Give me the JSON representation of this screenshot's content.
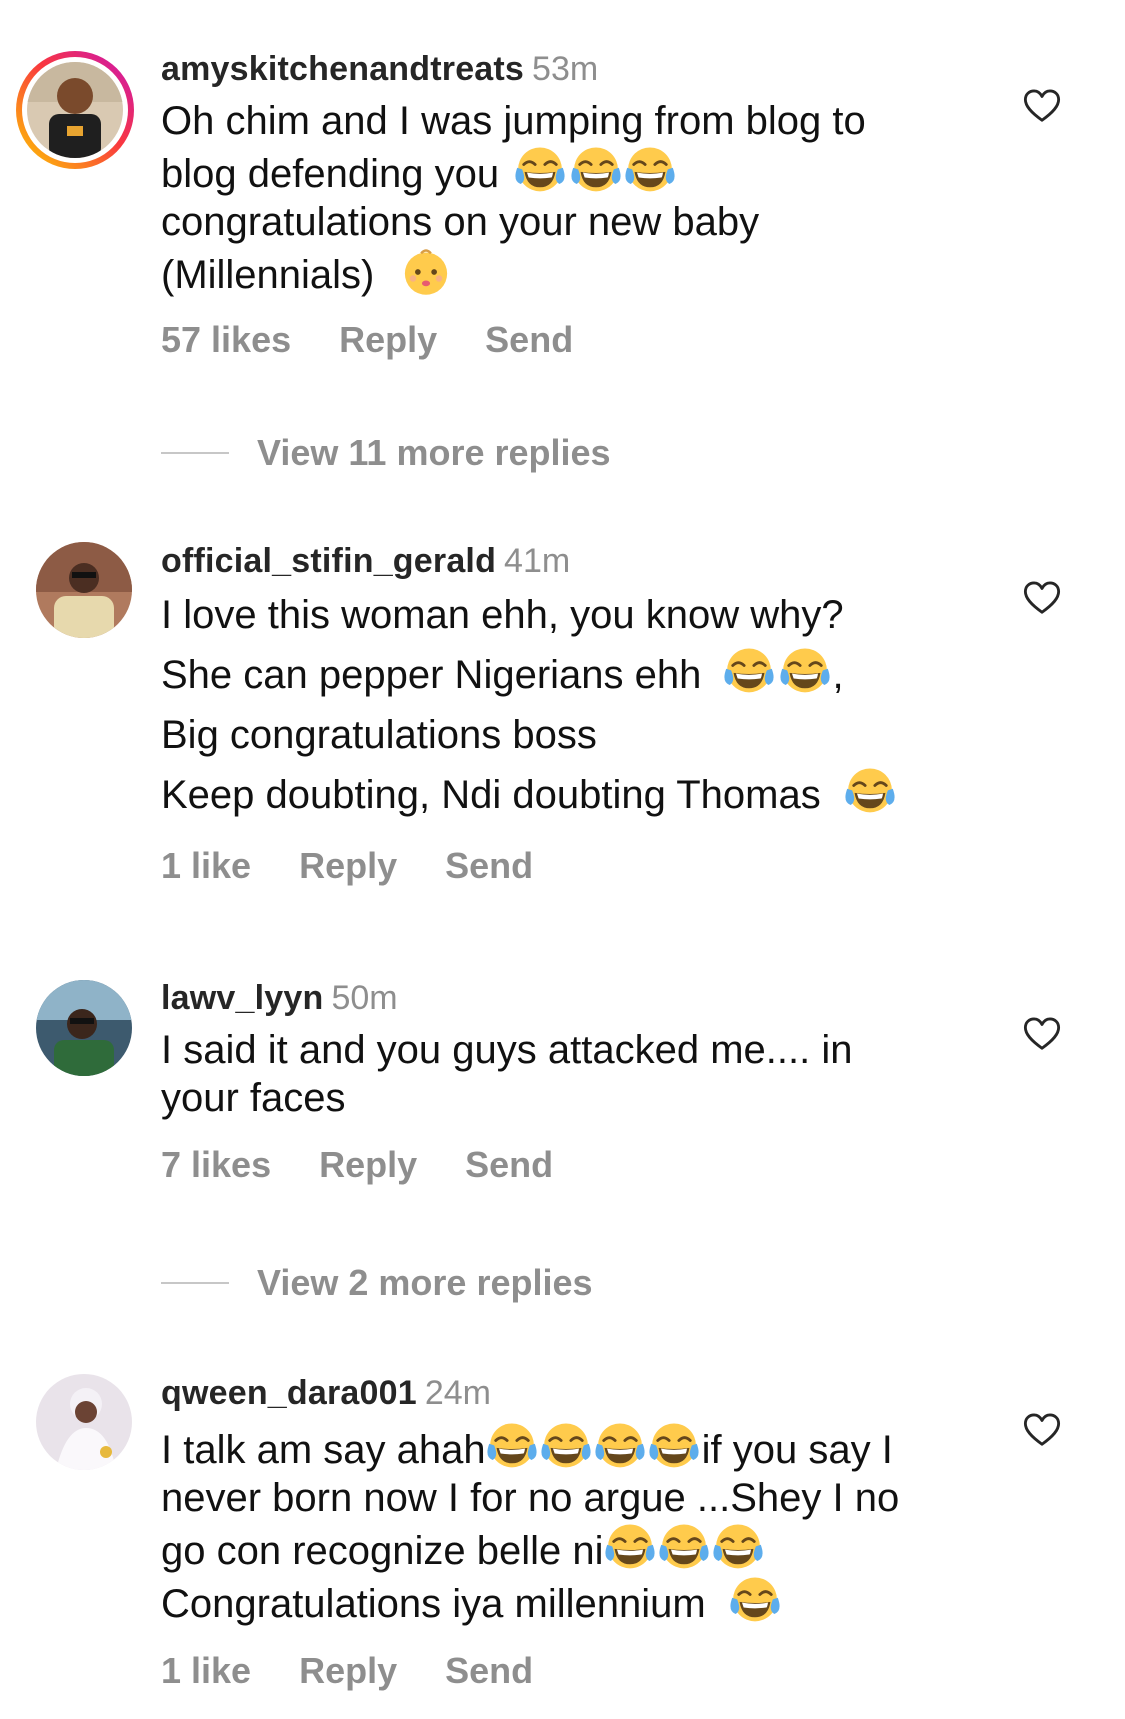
{
  "comments": [
    {
      "username": "amyskitchenandtreats",
      "time": "53m",
      "lines": [
        "Oh chim and I was jumping from blog to",
        "blog defending you",
        "congratulations on your new baby",
        "(Millennials)"
      ],
      "likes": "57 likes",
      "reply": "Reply",
      "send": "Send"
    },
    {
      "username": "official_stifin_gerald",
      "time": "41m",
      "lines": [
        "I love this woman ehh, you know why?",
        "She can pepper Nigerians ehh",
        ",",
        "Big congratulations boss",
        "Keep doubting, Ndi doubting Thomas"
      ],
      "likes": "1 like",
      "reply": "Reply",
      "send": "Send"
    },
    {
      "username": "lawv_lyyn",
      "time": "50m",
      "lines": [
        "I said it and you guys attacked me.... in",
        "your faces"
      ],
      "likes": "7 likes",
      "reply": "Reply",
      "send": "Send"
    },
    {
      "username": "qween_dara001",
      "time": "24m",
      "lines": [
        "I talk am say ahah",
        "if you say I",
        "never born now I for no argue ...Shey I no",
        "go con recognize belle ni",
        "Congratulations iya millennium"
      ],
      "likes": "1 like",
      "reply": "Reply",
      "send": "Send"
    }
  ],
  "view_more": [
    "View 11 more replies",
    "View 2 more replies"
  ],
  "icons": {
    "heart": "heart-outline-icon",
    "laugh": "face-with-tears-of-joy-emoji",
    "baby": "baby-emoji"
  },
  "colors": {
    "secondary_text": "#8e8e8e",
    "primary_text": "#111111",
    "story_ring_start": "#c913b9",
    "story_ring_end": "#fecd00"
  }
}
